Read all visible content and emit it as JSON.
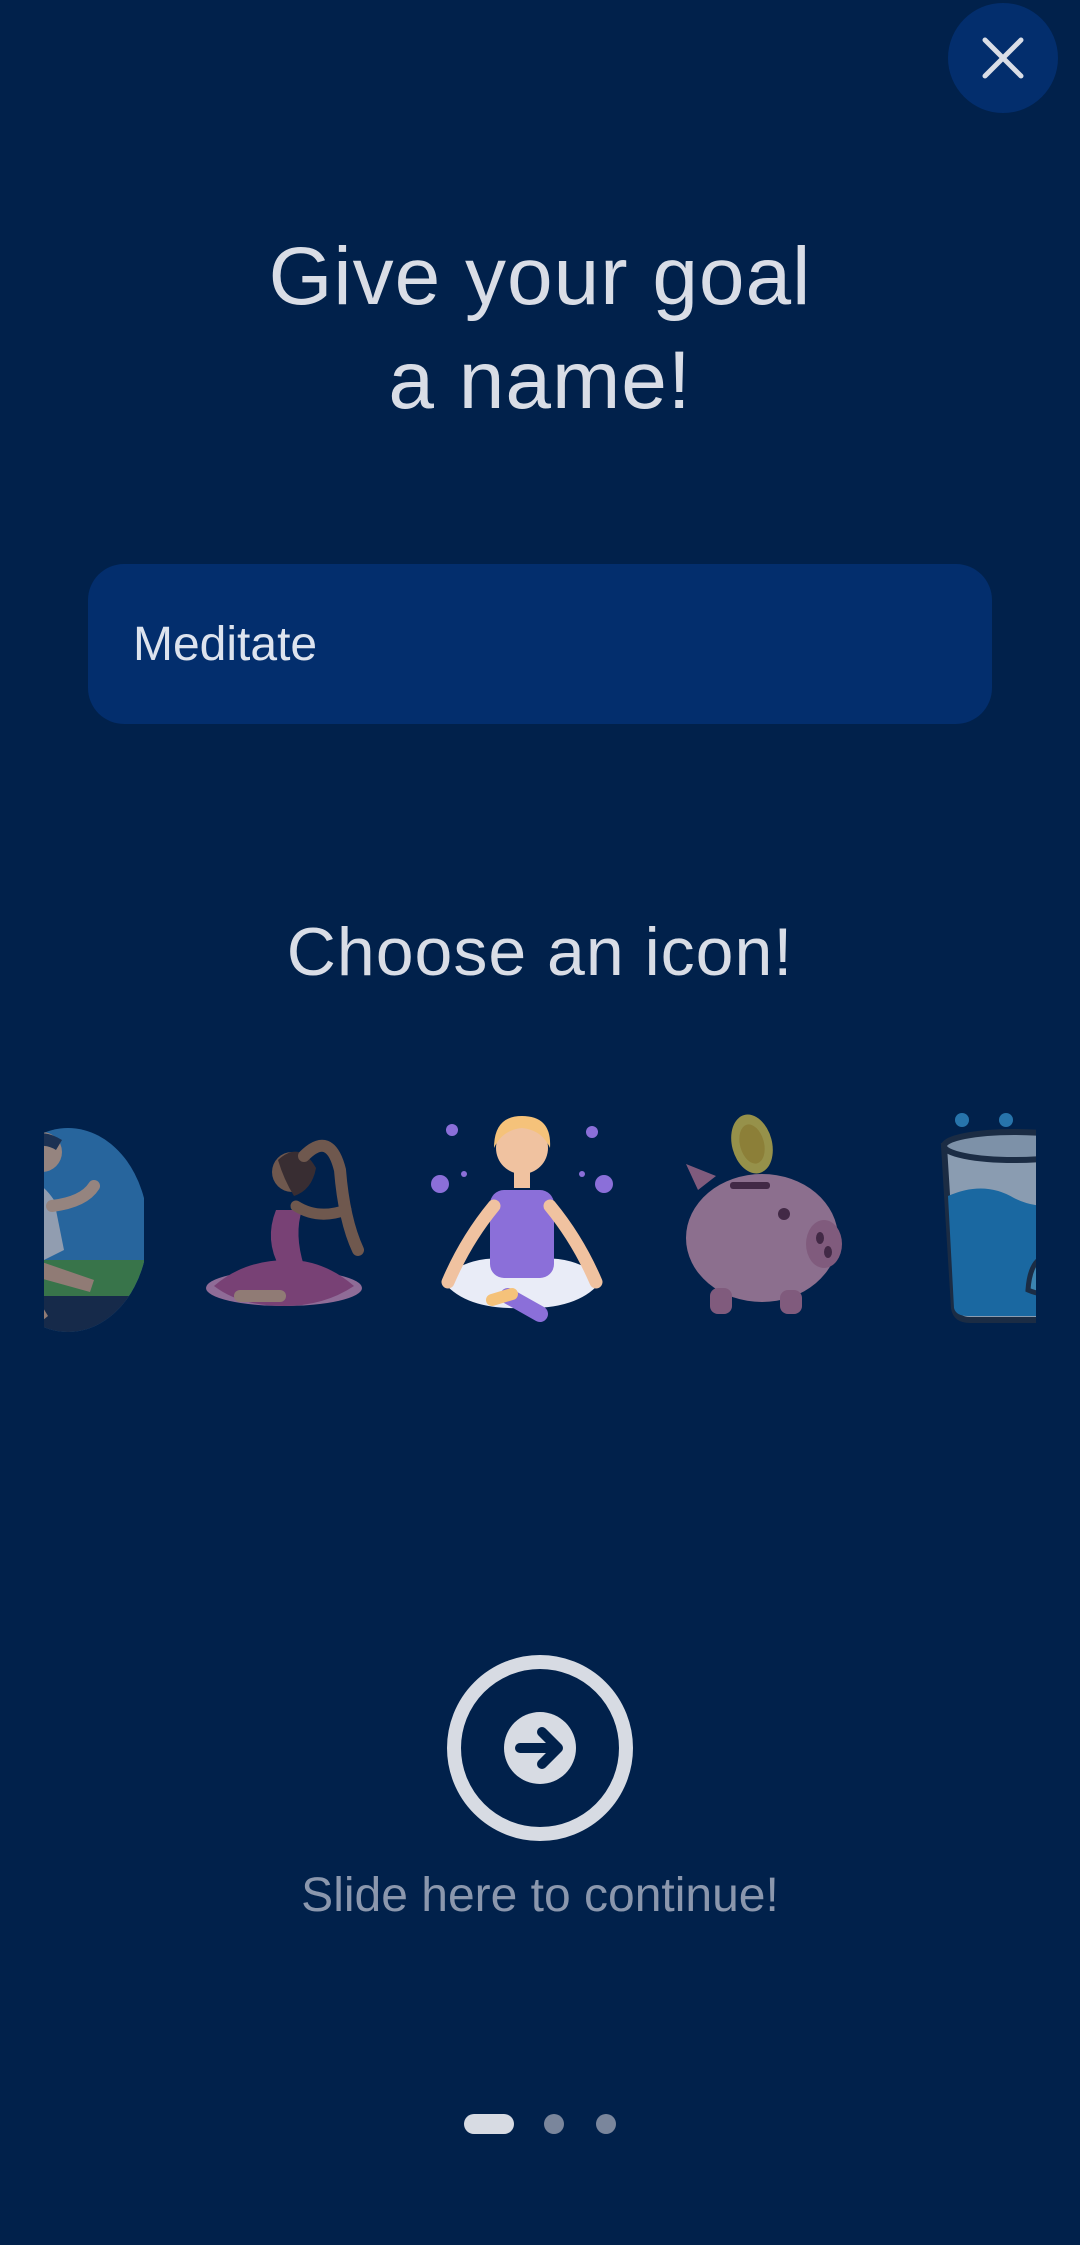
{
  "header": {
    "close_icon": "close-icon",
    "title_line1": "Give your goal",
    "title_line2": "a name!"
  },
  "name_field": {
    "value": "Meditate"
  },
  "icon_picker": {
    "heading": "Choose an icon!",
    "icons": [
      {
        "name": "runner-icon",
        "selected": false
      },
      {
        "name": "yoga-icon",
        "selected": false
      },
      {
        "name": "meditation-icon",
        "selected": true
      },
      {
        "name": "piggy-bank-icon",
        "selected": false
      },
      {
        "name": "water-glass-icon",
        "selected": false
      }
    ]
  },
  "continue": {
    "icon": "arrow-right-circle-icon",
    "label": "Slide here to continue!"
  },
  "pagination": {
    "total": 3,
    "current": 1
  },
  "colors": {
    "background": "#01214b",
    "field_background": "#032e6d",
    "text": "#d9dde6",
    "muted_text": "#8b97ad"
  }
}
